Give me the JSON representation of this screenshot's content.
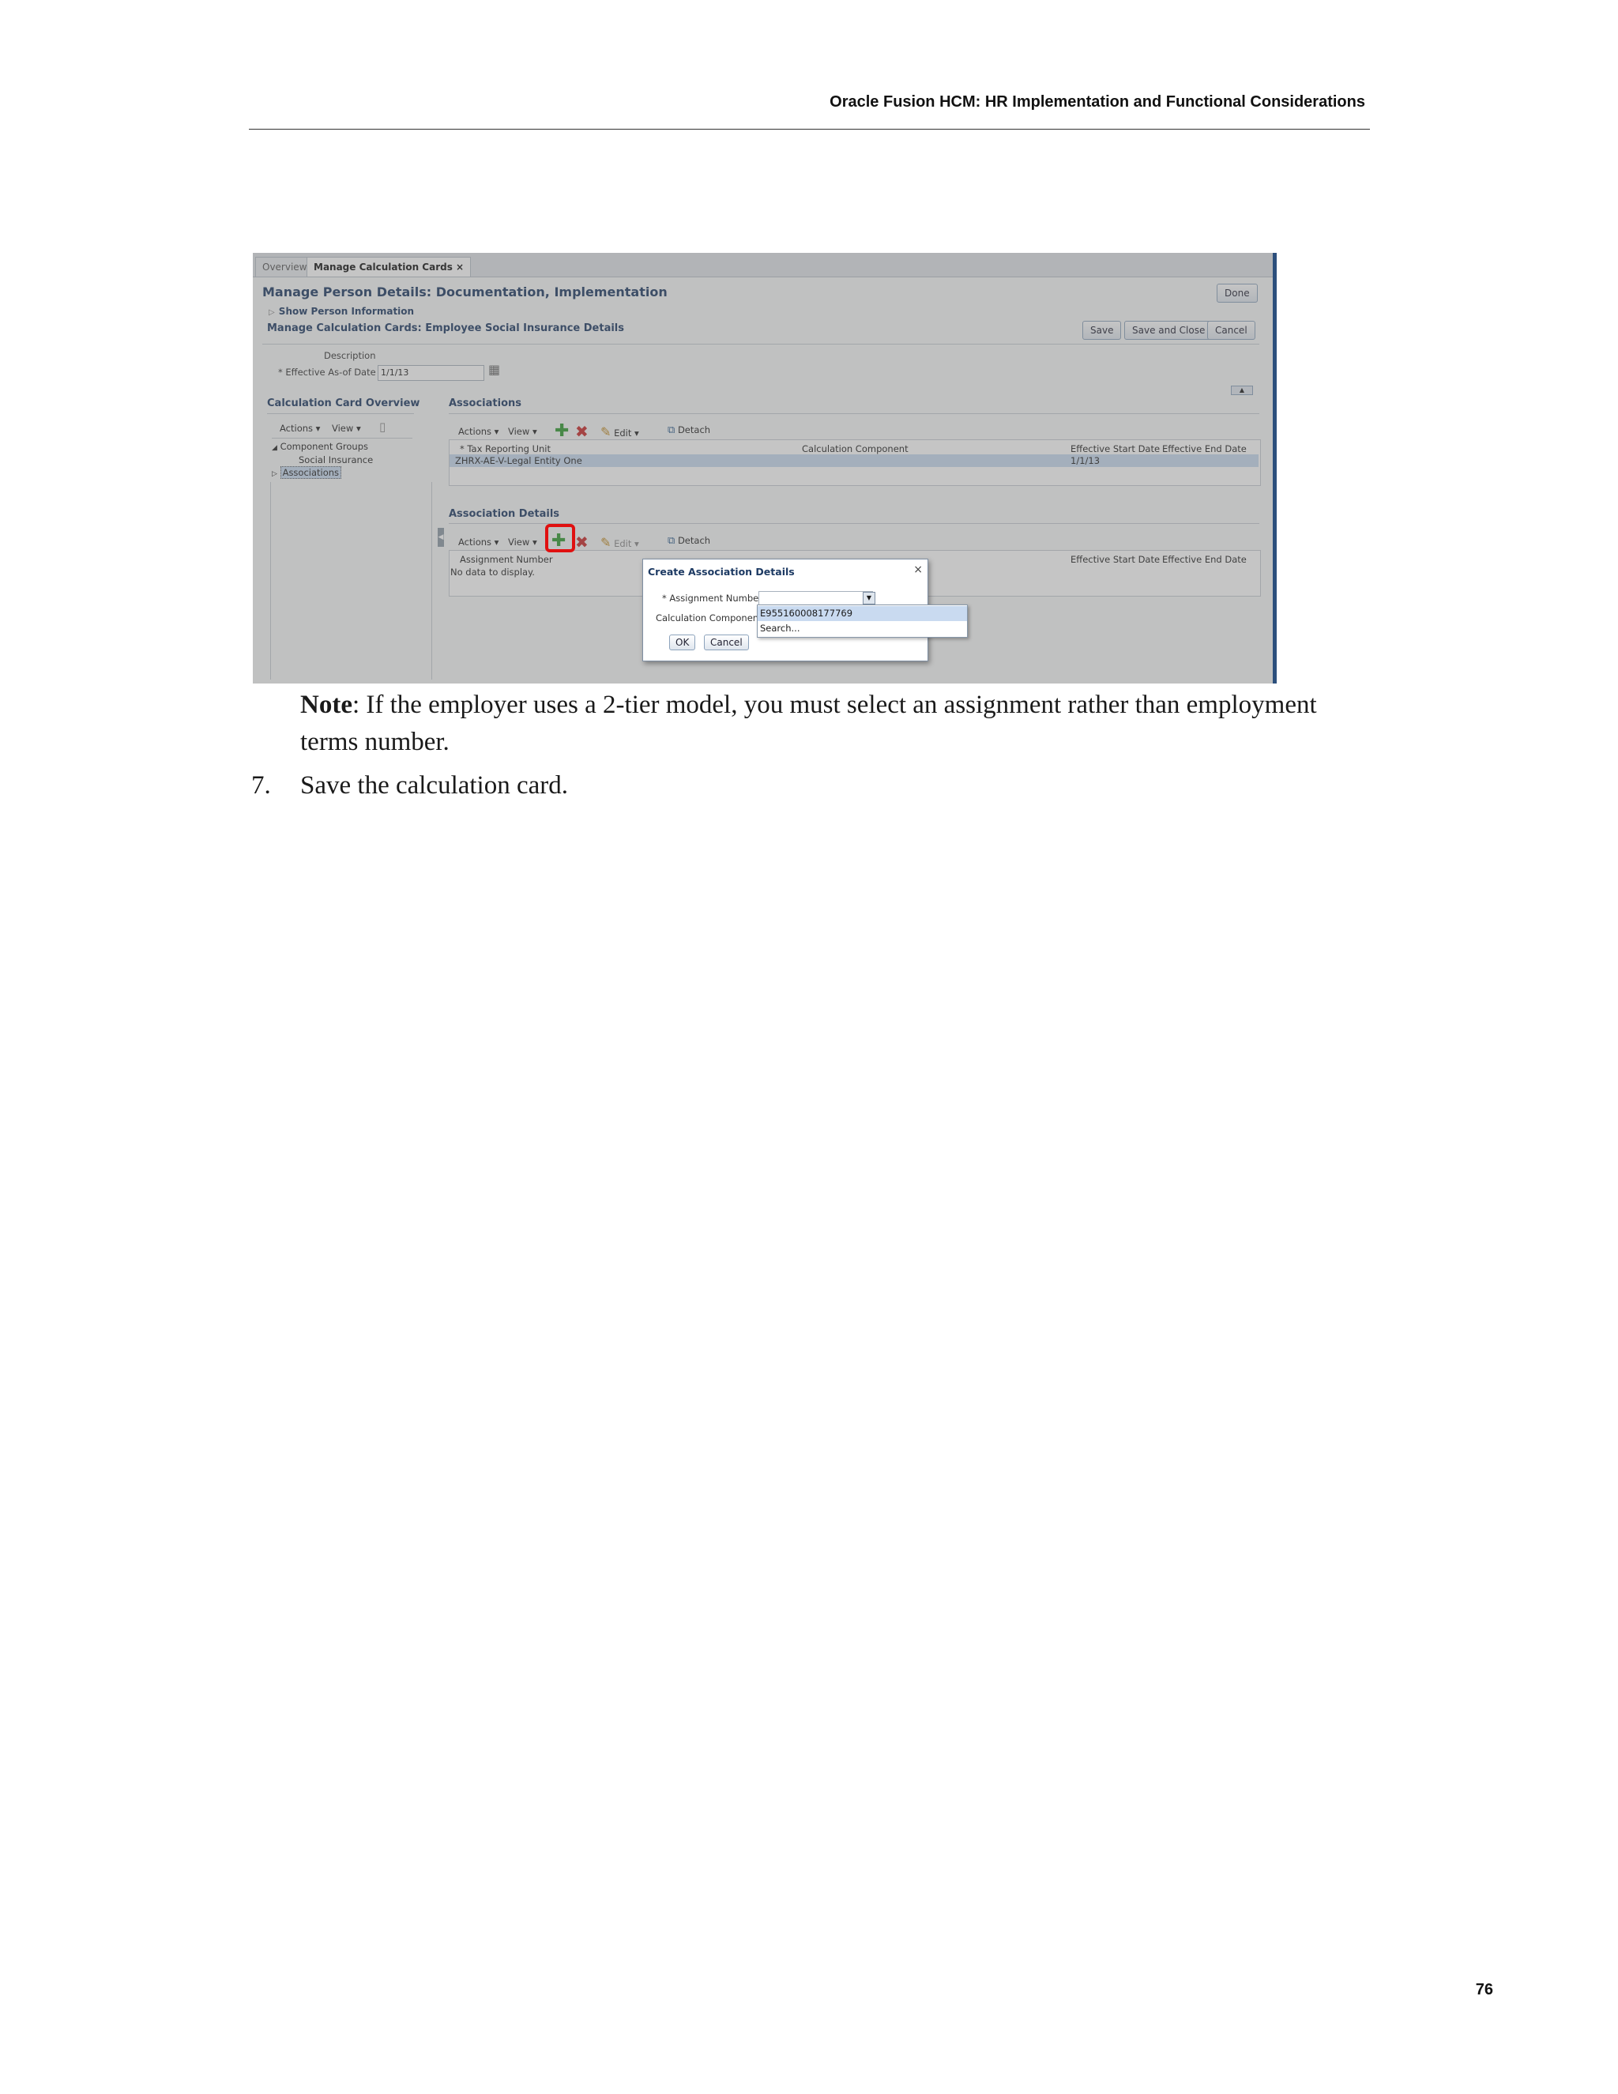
{
  "doc": {
    "header": "Oracle Fusion HCM: HR Implementation and Functional Considerations",
    "note_label": "Note",
    "note_text": ": If the employer uses a 2-tier model, you must select an assignment rather than employment terms number.",
    "step_number": "7.",
    "step_text": "Save the calculation card.",
    "page_number": "76"
  },
  "screenshot": {
    "tabs": [
      "Overview",
      "Manage Calculation Cards"
    ],
    "tab_close": "×",
    "page_title": "Manage Person Details: Documentation, Implementation",
    "show_person_info": "Show Person Information",
    "subtitle": "Manage Calculation Cards: Employee Social Insurance Details",
    "buttons": {
      "done": "Done",
      "save": "Save",
      "save_and_close": "Save and Close",
      "cancel": "Cancel"
    },
    "description_label": "Description",
    "effective_date_label": "* Effective As-of Date",
    "effective_date_value": "1/1/13",
    "overview": {
      "title": "Calculation Card Overview",
      "actions": "Actions ▾",
      "view": "View ▾",
      "tree": [
        "Component Groups",
        "Social Insurance",
        "Associations"
      ]
    },
    "associations": {
      "title": "Associations",
      "toolbar": {
        "actions": "Actions ▾",
        "view": "View ▾",
        "edit": "Edit ▾",
        "detach": "Detach"
      },
      "columns": [
        "* Tax Reporting Unit",
        "Calculation Component",
        "Effective Start Date",
        "Effective End Date"
      ],
      "row": {
        "tax_reporting_unit": "ZHRX-AE-V-Legal Entity One",
        "effective_start_date": "1/1/13"
      }
    },
    "association_details": {
      "title": "Association Details",
      "toolbar": {
        "actions": "Actions ▾",
        "view": "View ▾",
        "edit": "Edit ▾",
        "detach": "Detach"
      },
      "columns": [
        "Assignment Number",
        "Effective Start Date",
        "Effective End Date"
      ],
      "empty_text": "No data to display."
    },
    "dialog": {
      "title": "Create Association Details",
      "close": "×",
      "assignment_label": "* Assignment Number",
      "component_label": "Calculation Component",
      "ok": "OK",
      "cancel": "Cancel"
    },
    "dropdown": [
      "E955160008177769",
      "Search..."
    ]
  }
}
